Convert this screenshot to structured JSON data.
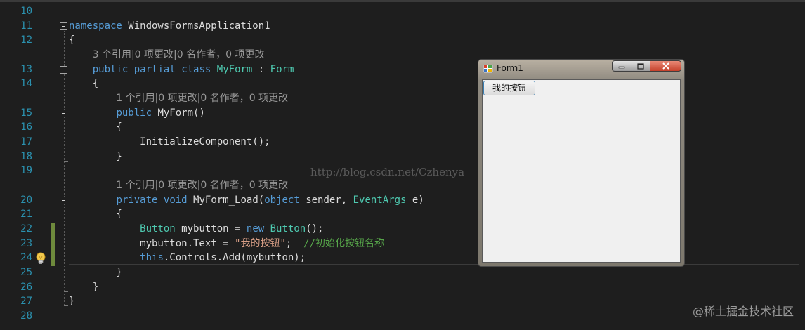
{
  "editor": {
    "lines": [
      {
        "num": "10"
      },
      {
        "num": "11",
        "tokens": [
          {
            "t": "namespace",
            "c": "kw"
          },
          {
            "t": " WindowsFormsApplication1"
          }
        ]
      },
      {
        "num": "12",
        "tokens": [
          {
            "t": "{"
          }
        ]
      },
      {
        "lens": "3 个引用|0 项更改|0 名作者，0 项更改"
      },
      {
        "num": "13",
        "tokens": [
          {
            "t": "    "
          },
          {
            "t": "public",
            "c": "kw"
          },
          {
            "t": " "
          },
          {
            "t": "partial",
            "c": "kw"
          },
          {
            "t": " "
          },
          {
            "t": "class",
            "c": "kw"
          },
          {
            "t": " "
          },
          {
            "t": "MyForm",
            "c": "ty"
          },
          {
            "t": " : "
          },
          {
            "t": "Form",
            "c": "ty"
          }
        ]
      },
      {
        "num": "14",
        "tokens": [
          {
            "t": "    {"
          }
        ]
      },
      {
        "lens": "1 个引用|0 项更改|0 名作者，0 项更改"
      },
      {
        "num": "15",
        "tokens": [
          {
            "t": "        "
          },
          {
            "t": "public",
            "c": "kw"
          },
          {
            "t": " MyForm()"
          }
        ]
      },
      {
        "num": "16",
        "tokens": [
          {
            "t": "        {"
          }
        ]
      },
      {
        "num": "17",
        "tokens": [
          {
            "t": "            InitializeComponent();"
          }
        ]
      },
      {
        "num": "18",
        "tokens": [
          {
            "t": "        }"
          }
        ]
      },
      {
        "num": "19"
      },
      {
        "lens": "1 个引用|0 项更改|0 名作者，0 项更改"
      },
      {
        "num": "20",
        "tokens": [
          {
            "t": "        "
          },
          {
            "t": "private",
            "c": "kw"
          },
          {
            "t": " "
          },
          {
            "t": "void",
            "c": "kw"
          },
          {
            "t": " MyForm_Load("
          },
          {
            "t": "object",
            "c": "kw"
          },
          {
            "t": " sender, "
          },
          {
            "t": "EventArgs",
            "c": "ty"
          },
          {
            "t": " e)"
          }
        ]
      },
      {
        "num": "21",
        "tokens": [
          {
            "t": "        {"
          }
        ]
      },
      {
        "num": "22",
        "tokens": [
          {
            "t": "            "
          },
          {
            "t": "Button",
            "c": "ty"
          },
          {
            "t": " mybutton = "
          },
          {
            "t": "new",
            "c": "kw"
          },
          {
            "t": " "
          },
          {
            "t": "Button",
            "c": "ty"
          },
          {
            "t": "();"
          }
        ]
      },
      {
        "num": "23",
        "tokens": [
          {
            "t": "            mybutton.Text = "
          },
          {
            "t": "\"我的按钮\"",
            "c": "str"
          },
          {
            "t": ";  "
          },
          {
            "t": "//初始化按钮名称",
            "c": "cm"
          }
        ]
      },
      {
        "num": "24",
        "tokens": [
          {
            "t": "            "
          },
          {
            "t": "this",
            "c": "kw"
          },
          {
            "t": ".Controls.Add(mybutton);"
          }
        ]
      },
      {
        "num": "25",
        "tokens": [
          {
            "t": "        }"
          }
        ]
      },
      {
        "num": "26",
        "tokens": [
          {
            "t": "    }"
          }
        ]
      },
      {
        "num": "27",
        "tokens": [
          {
            "t": "}"
          }
        ]
      },
      {
        "num": "28"
      }
    ]
  },
  "form": {
    "title": "Form1",
    "button_label": "我的按钮"
  },
  "watermark": "http://blog.csdn.net/Czhenya",
  "site_watermark": "@稀土掘金技术社区",
  "colors": {
    "background": "#1e1e1e",
    "line_number": "#2b91af",
    "keyword": "#569cd6",
    "type": "#4ec9b0",
    "string": "#d69d85",
    "comment": "#57a64a",
    "lens": "#999999"
  },
  "icons": [
    "lightbulb-icon",
    "collapse-icon",
    "form-app-icon",
    "minimize-icon",
    "maximize-icon",
    "close-icon"
  ]
}
